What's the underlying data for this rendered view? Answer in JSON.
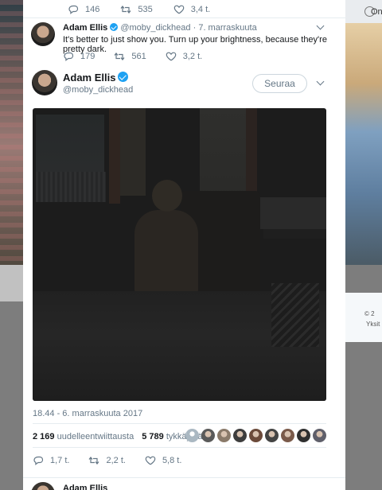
{
  "background": {
    "right_nav_text": "Onk",
    "right_card_line1": "© 2",
    "right_card_line2": "Yksit"
  },
  "top_tweet_actions": {
    "replies": "146",
    "retweets": "535",
    "likes": "3,4 t."
  },
  "reply_tweet": {
    "name": "Adam Ellis",
    "handle": "@moby_dickhead",
    "separator": "·",
    "date": "7. marraskuuta",
    "text": "It's better to just show you. Turn up your brightness, because they're pretty dark.",
    "actions": {
      "replies": "179",
      "retweets": "561",
      "likes": "3,2 t."
    }
  },
  "main_tweet": {
    "name": "Adam Ellis",
    "handle": "@moby_dickhead",
    "follow_label": "Seuraa",
    "timestamp": "18.44 - 6. marraskuuta 2017",
    "retweets_count": "2 169",
    "retweets_label": "uudelleentwiittausta",
    "likes_count": "5 789",
    "likes_label": "tykkäystä",
    "actions": {
      "replies": "1,7 t.",
      "retweets": "2,2 t.",
      "likes": "5,8 t."
    },
    "liker_colors": [
      "#aab8c2",
      "#5a5a5a",
      "#8a7a6a",
      "#3d3d3d",
      "#6b4a3a",
      "#444444",
      "#7a5a4a",
      "#2f2f2f",
      "#5f5f6a"
    ]
  },
  "next_tweet": {
    "name": "Adam Ellis"
  },
  "colors": {
    "accent": "#1da1f2",
    "muted": "#657786"
  }
}
